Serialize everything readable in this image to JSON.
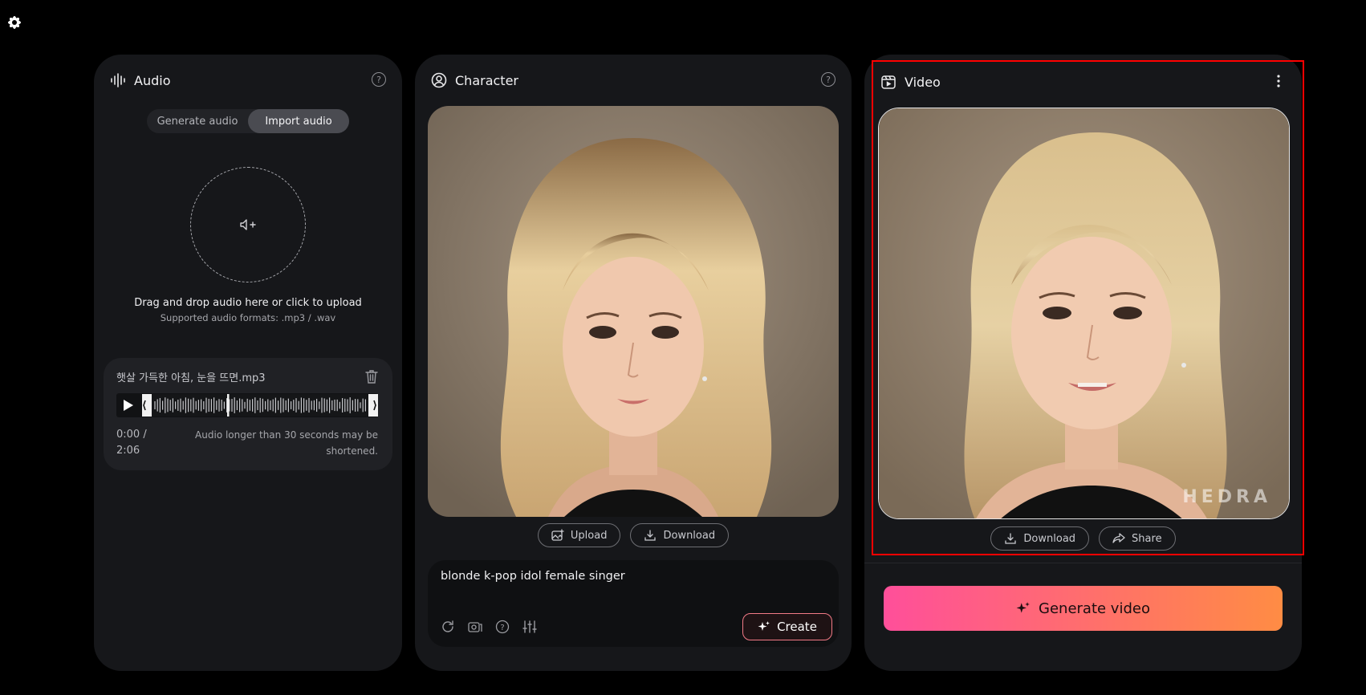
{
  "audio": {
    "title": "Audio",
    "help": "?",
    "tabs": [
      "Generate audio",
      "Import audio"
    ],
    "active_tab": "Import audio",
    "drop_text": "Drag and drop audio here or click to upload",
    "drop_sub": "Supported audio formats: .mp3 / .wav",
    "file": {
      "name": "햇살 가득한 아침, 눈을 뜨면.mp3",
      "time_current": "0:00 /",
      "time_total": "2:06",
      "warning": "Audio longer than 30 seconds may be shortened."
    }
  },
  "character": {
    "title": "Character",
    "help": "?",
    "upload_label": "Upload",
    "download_label": "Download",
    "prompt": "blonde k-pop idol female singer",
    "create_label": "Create"
  },
  "video": {
    "title": "Video",
    "watermark": "HEDRA",
    "download_label": "Download",
    "share_label": "Share",
    "generate_label": "Generate video"
  },
  "colors": {
    "background": "#000000",
    "panel": "#16171a",
    "accent_start": "#ff4f9a",
    "accent_end": "#ff8c44",
    "focus_outline": "#ff0000"
  }
}
